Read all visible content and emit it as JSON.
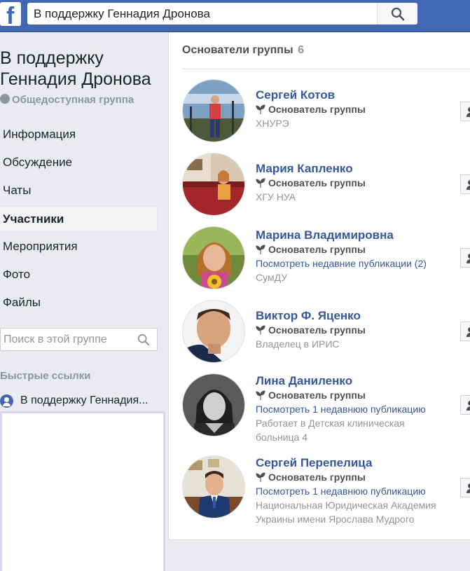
{
  "topbar": {
    "logo_letter": "f",
    "search_value": "В поддержку Геннадия Дронова"
  },
  "group": {
    "title": "В поддержку Геннадия Дронова",
    "privacy": "Общедоступная группа"
  },
  "nav": {
    "items": [
      {
        "label": "Информация"
      },
      {
        "label": "Обсуждение"
      },
      {
        "label": "Чаты"
      },
      {
        "label": "Участники"
      },
      {
        "label": "Мероприятия"
      },
      {
        "label": "Фото"
      },
      {
        "label": "Файлы"
      }
    ],
    "active_index": 3,
    "search_placeholder": "Поиск в этой группе"
  },
  "quick_links": {
    "title": "Быстрые ссылки",
    "items": [
      {
        "label": "В поддержку Геннадия..."
      }
    ]
  },
  "founders": {
    "title": "Основатели группы",
    "count": "6",
    "members": [
      {
        "name": "Сергей Котов",
        "role": "Основатель группы",
        "link": "",
        "lines": [
          "ХНУРЭ"
        ]
      },
      {
        "name": "Мария Капленко",
        "role": "Основатель группы",
        "link": "",
        "lines": [
          "ХГУ НУА"
        ]
      },
      {
        "name": "Марина Владимировна",
        "role": "Основатель группы",
        "link": "Посмотреть недавние публикации (2)",
        "lines": [
          "СумДУ"
        ]
      },
      {
        "name": "Виктор Ф. Яценко",
        "role": "Основатель группы",
        "link": "",
        "lines": [
          "Владелец в ИРИС"
        ]
      },
      {
        "name": "Лина Даниленко",
        "role": "Основатель группы",
        "link": "Посмотреть 1 недавнюю публикацию",
        "lines": [
          "Работает в Детская клиническая",
          "больница 4"
        ]
      },
      {
        "name": "Сергей Перепелица",
        "role": "Основатель группы",
        "link": "Посмотреть 1 недавнюю публикацию",
        "lines": [
          "Национальная Юридическая Академия",
          "Украины имени Ярослава Мудрого"
        ]
      }
    ]
  },
  "colors": {
    "topbar": "#4267b2",
    "link": "#365899",
    "muted": "#90949c",
    "page_bg": "#e9ebee"
  }
}
